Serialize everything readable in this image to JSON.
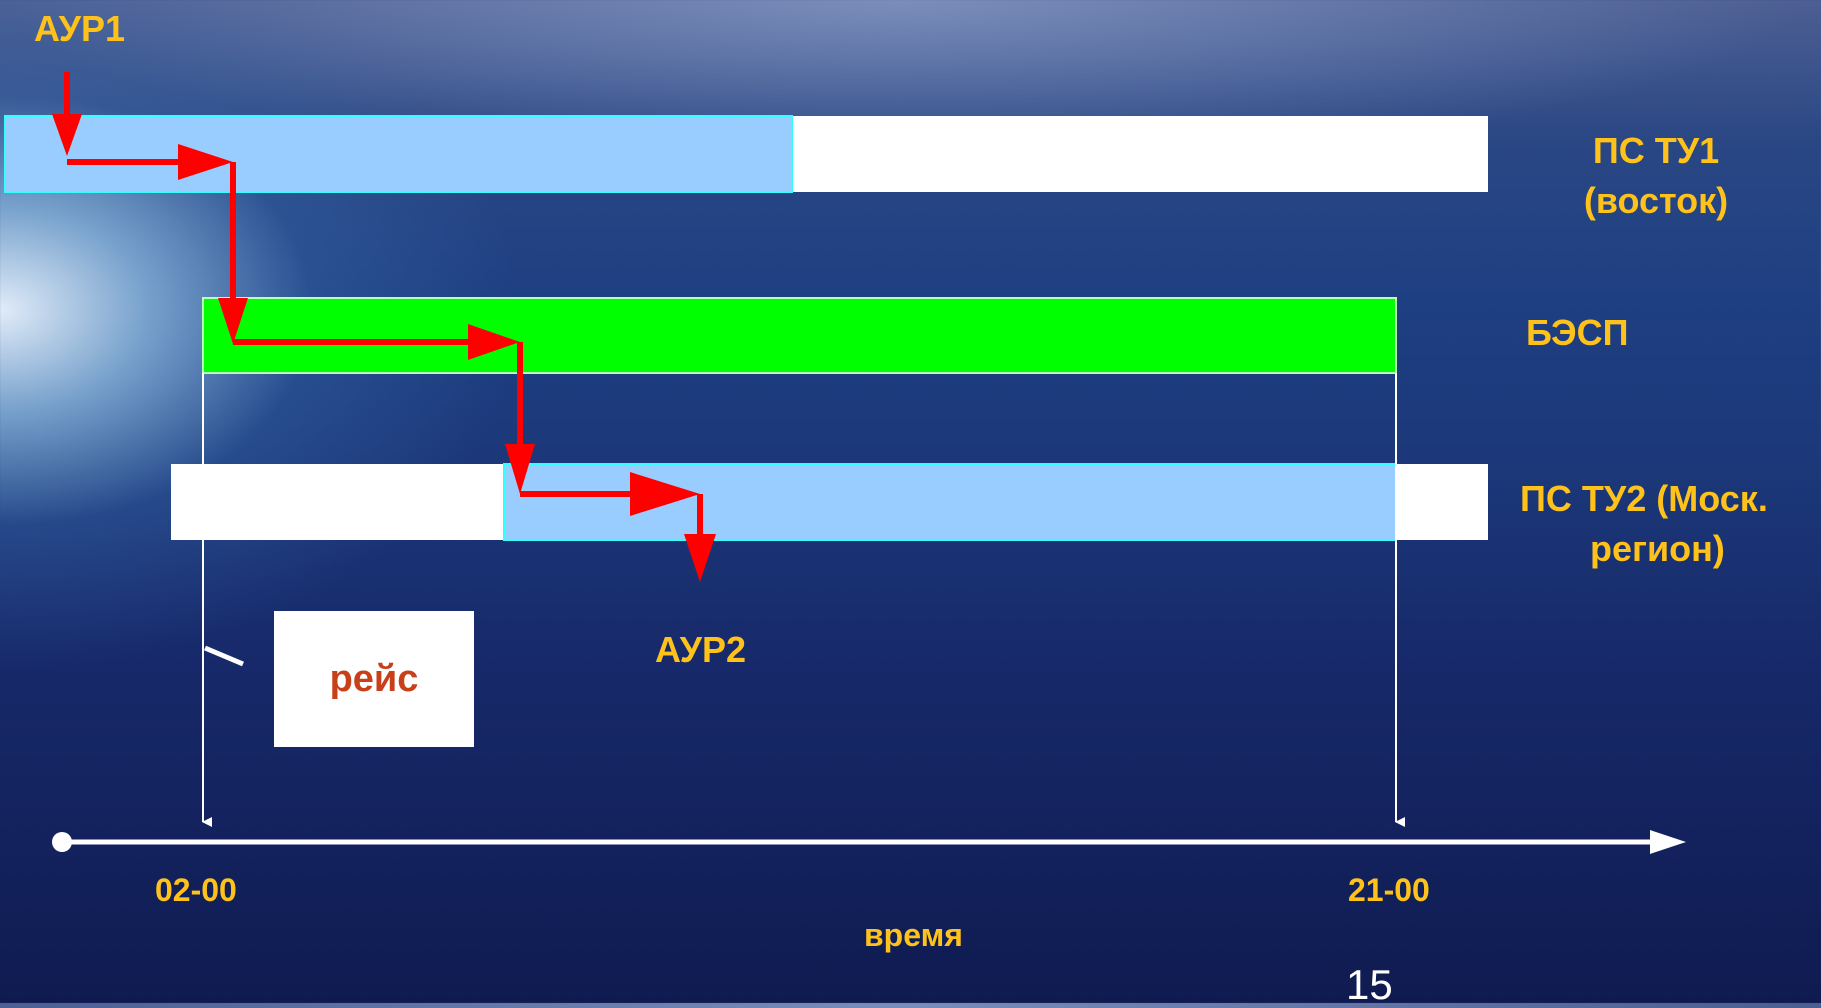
{
  "labels": {
    "aur1": "АУР1",
    "aur2": "АУР2",
    "ps_tu1_line1": "ПС ТУ1",
    "ps_tu1_line2": "(восток)",
    "besp": "БЭСП",
    "ps_tu2_line1": "ПС ТУ2 (Моск.",
    "ps_tu2_line2": "регион)",
    "flight": "рейс",
    "time_start": "02-00",
    "time_end": "21-00",
    "time_axis": "время",
    "page_number": "15"
  },
  "colors": {
    "label_yellow": "#ffc21a",
    "bar_white": "#ffffff",
    "bar_lightblue": "#99ccff",
    "bar_border_cyan": "#33ffff",
    "bar_green": "#00ff00",
    "flow_red": "#ff0000",
    "flight_text": "#c8401a"
  }
}
